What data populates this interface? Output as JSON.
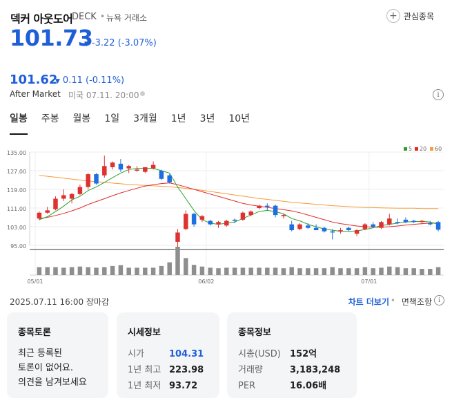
{
  "header": {
    "name": "덱커 아웃도어",
    "ticker": "DECK",
    "separator": "•",
    "exchange": "뉴욕 거래소",
    "watchlist_label": "관심종목"
  },
  "quote": {
    "price": "101.73",
    "change": "-3.22 (-3.07%)",
    "after_price": "101.62",
    "after_change": "0.11 (-0.11%)",
    "after_label": "After Market",
    "after_time": "미국 07.11. 20:00"
  },
  "tabs": [
    "일봉",
    "주봉",
    "월봉",
    "1일",
    "3개월",
    "1년",
    "3년",
    "10년"
  ],
  "chart_data": {
    "type": "candlestick",
    "y_ticks": [
      "135.00",
      "127.00",
      "119.00",
      "111.00",
      "103.00",
      "95.00"
    ],
    "ylim": [
      95,
      135
    ],
    "x_ticks": [
      {
        "label": "05/01",
        "index": 0
      },
      {
        "label": "06/02",
        "index": 21
      },
      {
        "label": "07/01",
        "index": 41
      }
    ],
    "legend": [
      {
        "name": "5",
        "color": "#2ca02c"
      },
      {
        "name": "20",
        "color": "#e02b2b"
      },
      {
        "name": "60",
        "color": "#f59b3a"
      }
    ],
    "candles": [
      {
        "o": 106.5,
        "h": 109.5,
        "l": 105.8,
        "c": 109.0
      },
      {
        "o": 109.0,
        "h": 111.5,
        "l": 108.5,
        "c": 110.0
      },
      {
        "o": 110.5,
        "h": 116.0,
        "l": 110.0,
        "c": 115.0
      },
      {
        "o": 115.0,
        "h": 119.0,
        "l": 114.0,
        "c": 116.5
      },
      {
        "o": 115.0,
        "h": 117.5,
        "l": 113.0,
        "c": 117.0
      },
      {
        "o": 117.0,
        "h": 121.0,
        "l": 116.5,
        "c": 120.0
      },
      {
        "o": 120.0,
        "h": 126.0,
        "l": 119.0,
        "c": 125.5
      },
      {
        "o": 125.5,
        "h": 126.0,
        "l": 121.0,
        "c": 121.5
      },
      {
        "o": 125.0,
        "h": 133.5,
        "l": 124.0,
        "c": 129.0
      },
      {
        "o": 128.5,
        "h": 131.0,
        "l": 127.5,
        "c": 130.5
      },
      {
        "o": 130.0,
        "h": 132.0,
        "l": 126.5,
        "c": 127.5
      },
      {
        "o": 128.0,
        "h": 129.5,
        "l": 126.0,
        "c": 129.0
      },
      {
        "o": 127.0,
        "h": 129.0,
        "l": 126.5,
        "c": 127.5
      },
      {
        "o": 126.5,
        "h": 128.5,
        "l": 126.0,
        "c": 128.5
      },
      {
        "o": 128.0,
        "h": 131.0,
        "l": 127.5,
        "c": 129.5
      },
      {
        "o": 127.0,
        "h": 127.5,
        "l": 123.0,
        "c": 123.5
      },
      {
        "o": 125.0,
        "h": 125.5,
        "l": 121.5,
        "c": 122.0
      },
      {
        "o": 96.5,
        "h": 102.0,
        "l": 94.0,
        "c": 100.5
      },
      {
        "o": 102.0,
        "h": 110.0,
        "l": 101.5,
        "c": 108.5
      },
      {
        "o": 108.5,
        "h": 109.0,
        "l": 103.0,
        "c": 104.0
      },
      {
        "o": 106.0,
        "h": 108.0,
        "l": 105.0,
        "c": 107.5
      },
      {
        "o": 105.5,
        "h": 106.0,
        "l": 103.5,
        "c": 104.0
      },
      {
        "o": 104.0,
        "h": 105.5,
        "l": 102.5,
        "c": 105.0
      },
      {
        "o": 103.5,
        "h": 106.0,
        "l": 103.0,
        "c": 105.5
      },
      {
        "o": 106.0,
        "h": 106.5,
        "l": 104.5,
        "c": 105.5
      },
      {
        "o": 106.0,
        "h": 109.5,
        "l": 105.5,
        "c": 109.0
      },
      {
        "o": 108.0,
        "h": 110.0,
        "l": 107.5,
        "c": 109.5
      },
      {
        "o": 111.0,
        "h": 112.5,
        "l": 110.5,
        "c": 112.0
      },
      {
        "o": 112.0,
        "h": 113.0,
        "l": 110.0,
        "c": 111.5
      },
      {
        "o": 112.0,
        "h": 112.5,
        "l": 107.0,
        "c": 108.0
      },
      {
        "o": 107.5,
        "h": 108.5,
        "l": 106.5,
        "c": 108.0
      },
      {
        "o": 104.0,
        "h": 105.5,
        "l": 101.0,
        "c": 101.5
      },
      {
        "o": 102.0,
        "h": 104.5,
        "l": 101.5,
        "c": 104.0
      },
      {
        "o": 103.5,
        "h": 104.5,
        "l": 102.0,
        "c": 102.5
      },
      {
        "o": 102.5,
        "h": 104.0,
        "l": 101.5,
        "c": 101.5
      },
      {
        "o": 102.5,
        "h": 103.0,
        "l": 100.5,
        "c": 101.0
      },
      {
        "o": 101.0,
        "h": 102.0,
        "l": 97.5,
        "c": 100.5
      },
      {
        "o": 101.0,
        "h": 102.5,
        "l": 100.0,
        "c": 101.5
      },
      {
        "o": 102.5,
        "h": 103.0,
        "l": 101.0,
        "c": 101.5
      },
      {
        "o": 100.0,
        "h": 102.0,
        "l": 99.0,
        "c": 101.5
      },
      {
        "o": 102.0,
        "h": 104.5,
        "l": 101.5,
        "c": 104.0
      },
      {
        "o": 104.0,
        "h": 105.0,
        "l": 102.5,
        "c": 103.0
      },
      {
        "o": 102.5,
        "h": 105.5,
        "l": 102.0,
        "c": 105.0
      },
      {
        "o": 104.0,
        "h": 108.5,
        "l": 103.5,
        "c": 106.5
      },
      {
        "o": 105.0,
        "h": 106.5,
        "l": 104.0,
        "c": 104.5
      },
      {
        "o": 106.0,
        "h": 107.0,
        "l": 104.5,
        "c": 105.0
      },
      {
        "o": 105.5,
        "h": 106.0,
        "l": 104.5,
        "c": 105.0
      },
      {
        "o": 105.0,
        "h": 106.0,
        "l": 104.0,
        "c": 105.5
      },
      {
        "o": 104.5,
        "h": 105.5,
        "l": 103.5,
        "c": 104.0
      },
      {
        "o": 105.0,
        "h": 105.5,
        "l": 101.0,
        "c": 101.7
      }
    ],
    "ma5": [
      106.0,
      107.3,
      109.5,
      111.8,
      114.5,
      116.0,
      118.5,
      120.0,
      122.0,
      124.0,
      126.0,
      127.5,
      128.0,
      128.0,
      128.0,
      127.0,
      126.0,
      120.0,
      115.0,
      110.0,
      106.0,
      104.5,
      104.0,
      104.5,
      105.0,
      106.5,
      108.0,
      109.5,
      110.0,
      109.5,
      108.5,
      106.5,
      105.5,
      104.0,
      103.0,
      102.0,
      101.5,
      101.0,
      101.0,
      101.2,
      101.8,
      102.5,
      103.5,
      104.0,
      104.5,
      105.0,
      105.2,
      105.3,
      105.0,
      104.0
    ],
    "ma20": [
      106.5,
      107.0,
      107.8,
      108.7,
      109.8,
      111.0,
      112.5,
      113.8,
      115.0,
      116.3,
      117.5,
      118.5,
      119.5,
      120.4,
      121.0,
      121.5,
      121.8,
      121.0,
      120.0,
      119.0,
      118.0,
      117.0,
      116.0,
      115.0,
      114.0,
      113.0,
      112.3,
      111.8,
      111.3,
      110.8,
      110.3,
      109.8,
      109.0,
      108.0,
      107.0,
      106.0,
      105.0,
      104.3,
      103.8,
      103.3,
      103.0,
      102.8,
      102.8,
      103.0,
      103.3,
      103.7,
      104.0,
      104.3,
      104.5,
      104.5
    ],
    "ma60": [
      125.0,
      124.6,
      124.2,
      123.8,
      123.4,
      123.0,
      122.6,
      122.3,
      122.0,
      121.7,
      121.4,
      121.1,
      120.9,
      120.7,
      120.5,
      120.3,
      120.1,
      119.8,
      119.4,
      119.0,
      118.6,
      118.1,
      117.6,
      117.1,
      116.6,
      116.1,
      115.6,
      115.1,
      114.7,
      114.3,
      113.9,
      113.5,
      113.2,
      112.9,
      112.6,
      112.3,
      112.0,
      111.8,
      111.6,
      111.4,
      111.3,
      111.2,
      111.1,
      111.0,
      110.9,
      110.9,
      110.9,
      110.8,
      110.8,
      110.8
    ],
    "volume": [
      0.28,
      0.28,
      0.28,
      0.26,
      0.28,
      0.3,
      0.28,
      0.26,
      0.28,
      0.32,
      0.35,
      0.26,
      0.26,
      0.26,
      0.26,
      0.32,
      0.45,
      1.0,
      0.6,
      0.36,
      0.3,
      0.26,
      0.24,
      0.26,
      0.26,
      0.26,
      0.26,
      0.26,
      0.26,
      0.26,
      0.24,
      0.28,
      0.24,
      0.24,
      0.24,
      0.24,
      0.28,
      0.24,
      0.24,
      0.24,
      0.28,
      0.24,
      0.26,
      0.3,
      0.28,
      0.24,
      0.24,
      0.22,
      0.22,
      0.28
    ]
  },
  "footer": {
    "date_status": "2025.07.11 16:00 장마감",
    "more_chart": "차트 더보기",
    "separator": "•",
    "disclaimer": "면책조항"
  },
  "cards": {
    "discussion": {
      "title": "종목토론",
      "lines": [
        "최근 등록된",
        "토론이 없어요.",
        "의견을 남겨보세요"
      ]
    },
    "market": {
      "title": "시세정보",
      "rows": [
        {
          "label": "시가",
          "value": "104.31"
        },
        {
          "label": "1년 최고",
          "value": "223.98"
        },
        {
          "label": "1년 최저",
          "value": "93.72"
        }
      ]
    },
    "stock": {
      "title": "종목정보",
      "rows": [
        {
          "label": "시총(USD)",
          "value": "152억"
        },
        {
          "label": "거래량",
          "value": "3,183,248"
        },
        {
          "label": "PER",
          "value": "16.06배"
        }
      ]
    }
  },
  "colors": {
    "up": "#e03131",
    "down": "#1e6fe0",
    "accent": "#1e5fd8"
  }
}
